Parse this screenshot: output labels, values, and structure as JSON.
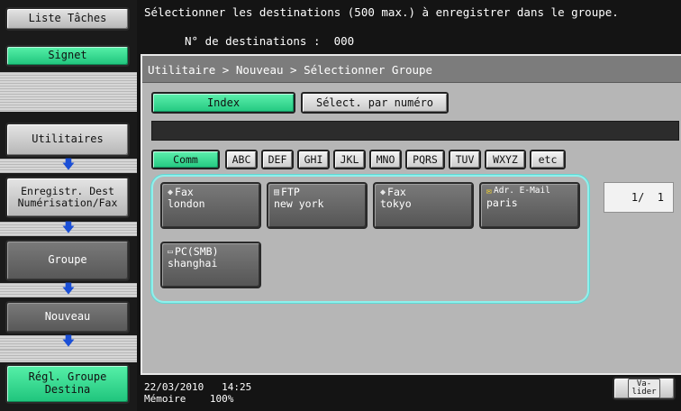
{
  "sidebar": {
    "task_list": "Liste Tâches",
    "bookmark": "Signet",
    "steps": [
      "Utilitaires",
      "Enregistr. Dest\nNumérisation/Fax",
      "Groupe",
      "Nouveau",
      "Régl. Groupe\nDestina"
    ],
    "arrow_glyph": "🡇"
  },
  "message": "Sélectionner les destinations (500 max.) à enregistrer dans le groupe.",
  "dest_count": {
    "label": "N° de destinations :",
    "value": "000"
  },
  "breadcrumb": "Utilitaire > Nouveau > Sélectionner Groupe",
  "mode_tabs": {
    "index": "Index",
    "by_number": "Sélect. par numéro"
  },
  "index_tabs": [
    "Comm",
    "ABC",
    "DEF",
    "GHI",
    "JKL",
    "MNO",
    "PQRS",
    "TUV",
    "WXYZ",
    "etc"
  ],
  "active_index_tab": "Comm",
  "destinations": [
    {
      "type": "Fax",
      "icon": "fax-icon",
      "name": "london"
    },
    {
      "type": "FTP",
      "icon": "ftp-icon",
      "name": "new york"
    },
    {
      "type": "Fax",
      "icon": "fax-icon",
      "name": "tokyo"
    },
    {
      "type": "Adr. E-Mail",
      "icon": "email-icon",
      "name": "paris"
    },
    {
      "type": "PC(SMB)",
      "icon": "pc-smb-icon",
      "name": "shanghai"
    }
  ],
  "page_indicator": "1/  1",
  "footer": {
    "date": "22/03/2010",
    "time": "14:25",
    "memory_label": "Mémoire",
    "memory_value": "100%",
    "valider": "Va-\nlider"
  },
  "colors": {
    "accent_green": "#2fd88e",
    "panel_grey": "#b6b6b6",
    "highlight_cyan": "#8ff0ec",
    "arrow_blue": "#1b4fd6"
  }
}
